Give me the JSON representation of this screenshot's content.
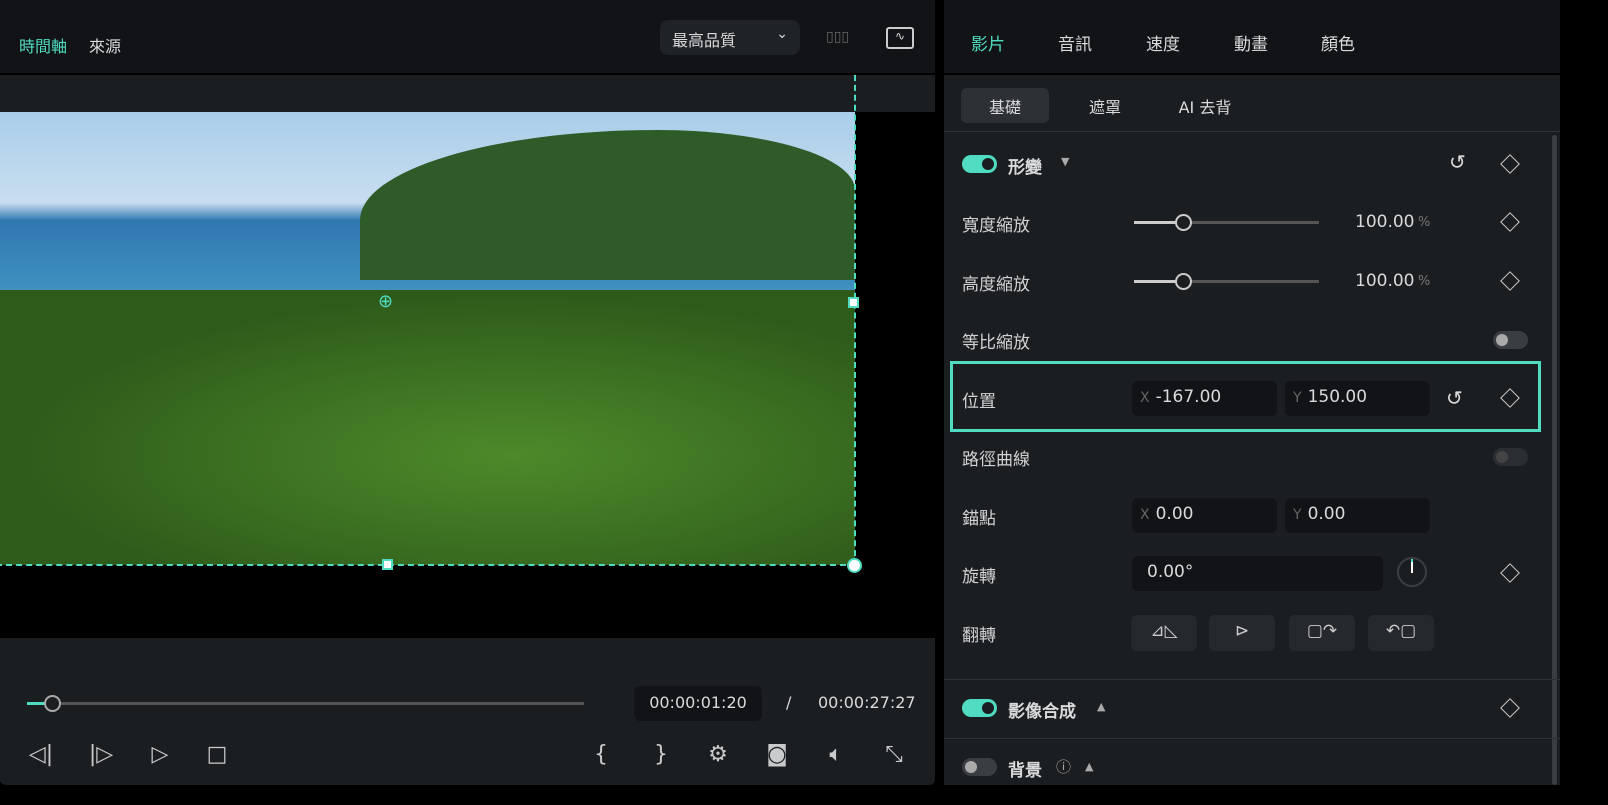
{
  "player": {
    "tabs": [
      "時間軸",
      "來源"
    ],
    "quality": "最高品質",
    "current_time": "00:00:01:20",
    "separator": "/",
    "total_time": "00:00:27:27",
    "progress_fraction": 0.045
  },
  "inspector": {
    "tabs": [
      "影片",
      "音訊",
      "速度",
      "動畫",
      "顏色"
    ],
    "subtabs": [
      "基礎",
      "遮罩",
      "AI 去背"
    ],
    "transform": {
      "title": "形變",
      "width_scale_label": "寬度縮放",
      "width_scale": "100.00",
      "height_scale_label": "高度縮放",
      "height_scale": "100.00",
      "unit": "%",
      "uniform_label": "等比縮放",
      "position_label": "位置",
      "pos_x": "-167.00",
      "pos_y": "150.00",
      "path_label": "路徑曲線",
      "anchor_label": "錨點",
      "anchor_x": "0.00",
      "anchor_y": "0.00",
      "rotate_label": "旋轉",
      "rotate": "0.00°",
      "flip_label": "翻轉",
      "x": "X",
      "y": "Y"
    },
    "compositing": {
      "title": "影像合成"
    },
    "background": {
      "title": "背景"
    }
  },
  "colors": {
    "accent": "#4fdcc0"
  }
}
